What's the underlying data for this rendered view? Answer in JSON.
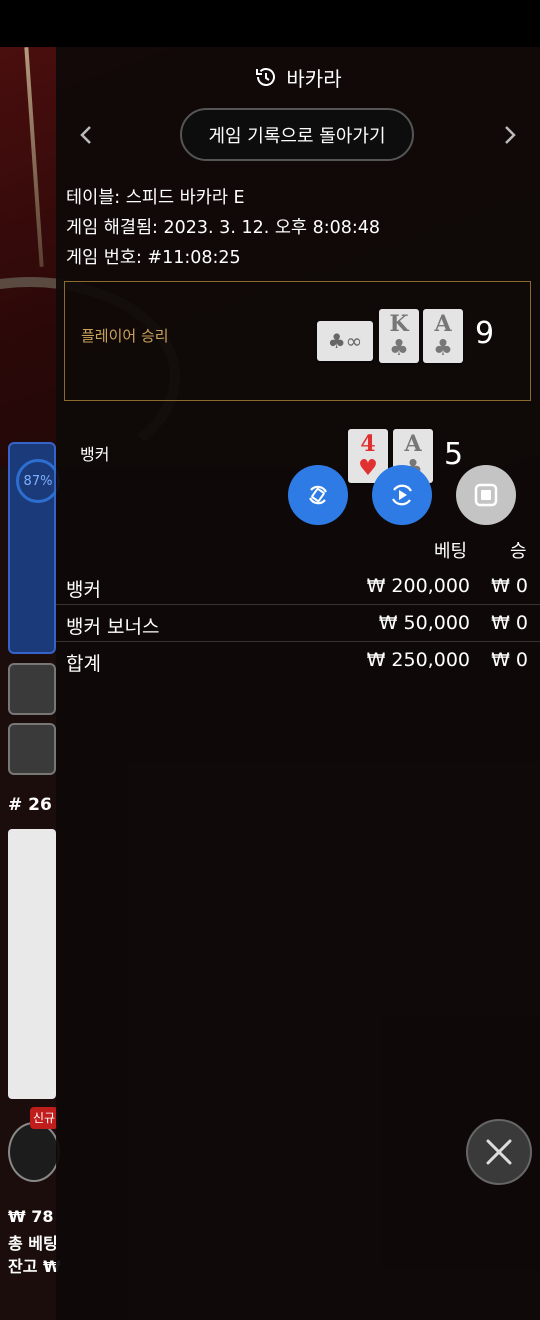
{
  "background_game": {
    "percent": "87%",
    "round_no": "# 26",
    "new_tag": "신규",
    "foot_balance": "₩ 78",
    "foot_total_bet": "총 베팅",
    "foot_remaining": "잔고 ₩"
  },
  "panel": {
    "title": "바카라",
    "back_button": "게임 기록으로 돌아가기",
    "info": {
      "table": "테이블: 스피드 바카라 E",
      "resolved": "게임 해결됨: 2023. 3. 12. 오후 8:08:48",
      "game_number": "게임 번호: #11:08:25"
    },
    "player": {
      "label": "플레이어 승리",
      "cards": [
        {
          "rank": "♣∞",
          "suit": "",
          "color": "black",
          "kind": "wide"
        },
        {
          "rank": "K",
          "suit": "♣",
          "color": "black",
          "kind": "normal"
        },
        {
          "rank": "A",
          "suit": "♣",
          "color": "black",
          "kind": "normal"
        }
      ],
      "score": "9"
    },
    "banker": {
      "label": "뱅커",
      "cards": [
        {
          "rank": "4",
          "suit": "♥",
          "color": "red"
        },
        {
          "rank": "A",
          "suit": "♣",
          "color": "black"
        }
      ],
      "score": "5"
    },
    "controls": {
      "replay_icon": "rotate-icon",
      "play_icon": "play-icon",
      "stop_icon": "stop-icon",
      "accent": "#2f7be6"
    },
    "bets_table": {
      "col_bet": "베팅",
      "col_win": "승",
      "rows": [
        {
          "name": "뱅커",
          "bet": "₩ 200,000",
          "win": "₩ 0"
        },
        {
          "name": "뱅커 보너스",
          "bet": "₩ 50,000",
          "win": "₩ 0"
        },
        {
          "name": "합계",
          "bet": "₩ 250,000",
          "win": "₩ 0"
        }
      ]
    }
  }
}
